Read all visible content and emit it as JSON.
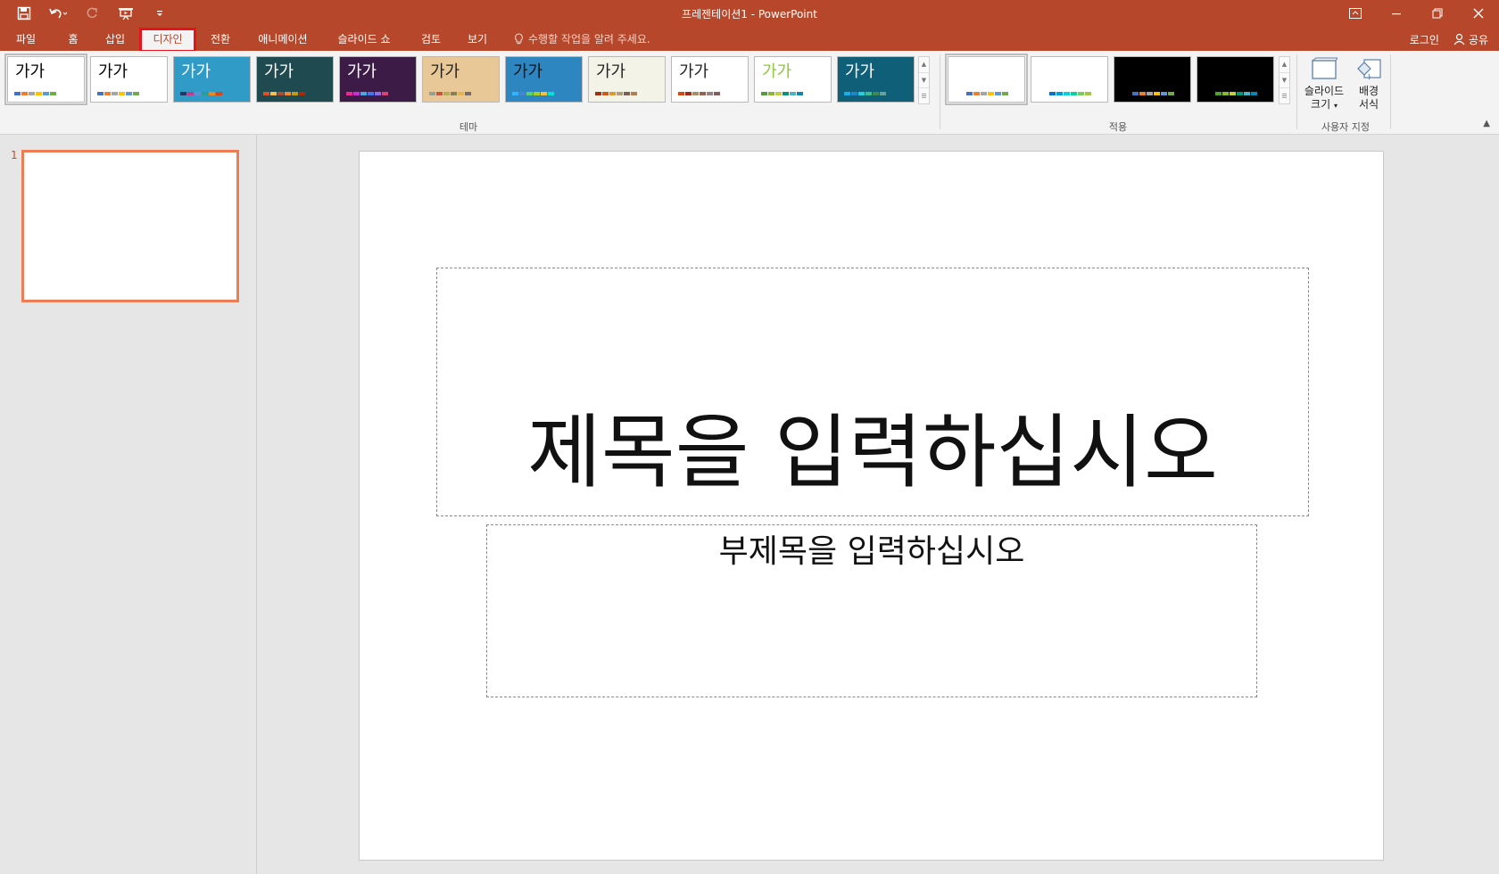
{
  "window": {
    "title": "프레젠테이션1 - PowerPoint"
  },
  "qat": {
    "icons": [
      "save-icon",
      "undo-icon",
      "redo-icon",
      "start-from-beginning-icon",
      "customize-qat-icon"
    ]
  },
  "tabs": [
    {
      "label": "파일"
    },
    {
      "label": "홈"
    },
    {
      "label": "삽입"
    },
    {
      "label": "디자인",
      "active": true
    },
    {
      "label": "전환"
    },
    {
      "label": "애니메이션"
    },
    {
      "label": "슬라이드 쇼"
    },
    {
      "label": "검토"
    },
    {
      "label": "보기"
    }
  ],
  "tell_me": "수행할 작업을 알려 주세요.",
  "account": {
    "signin": "로그인",
    "share": "공유"
  },
  "ribbon": {
    "themes_group_label": "테마",
    "variants_group_label": "적용",
    "customize_group_label": "사용자 지정",
    "themes": [
      {
        "label": "가가",
        "bg": "#ffffff",
        "fg": "#000000",
        "swatches": [
          "#4472c4",
          "#ed7d31",
          "#a5a5a5",
          "#ffc000",
          "#5b9bd5",
          "#70ad47"
        ]
      },
      {
        "label": "가가",
        "bg": "#ffffff",
        "fg": "#000000",
        "swatches": [
          "#4472c4",
          "#ed7d31",
          "#a5a5a5",
          "#ffc000",
          "#5b9bd5",
          "#70ad47"
        ]
      },
      {
        "label": "가가",
        "bg": "#2f9bc6",
        "fg": "#ffffff",
        "swatches": [
          "#1f3864",
          "#b4418e",
          "#5f91d6",
          "#24a0a0",
          "#e08b29",
          "#d34817"
        ]
      },
      {
        "label": "가가",
        "bg": "#1f4a4f",
        "fg": "#ffffff",
        "swatches": [
          "#e84c22",
          "#ffbd47",
          "#b64926",
          "#ff8427",
          "#cc9900",
          "#b22600"
        ]
      },
      {
        "label": "가가",
        "bg": "#3c1c47",
        "fg": "#ffffff",
        "swatches": [
          "#e32d91",
          "#c830cc",
          "#4ea6dc",
          "#4775e7",
          "#8971e1",
          "#d54773"
        ]
      },
      {
        "label": "가가",
        "bg": "#e8c896",
        "fg": "#222222",
        "swatches": [
          "#93a299",
          "#cf543f",
          "#b5ae53",
          "#848058",
          "#e8b54d",
          "#786c71"
        ]
      },
      {
        "label": "가가",
        "bg": "#2e86c1",
        "fg": "#111111",
        "swatches": [
          "#31b6fd",
          "#4584d3",
          "#5bd078",
          "#a5d028",
          "#f5c040",
          "#05e0db"
        ]
      },
      {
        "label": "가가",
        "bg": "#f4f3e8",
        "fg": "#222222",
        "swatches": [
          "#a5300f",
          "#d55816",
          "#e19825",
          "#b19c7d",
          "#7f5f52",
          "#b27d49"
        ]
      },
      {
        "label": "가가",
        "bg": "#ffffff",
        "fg": "#222222",
        "swatches": [
          "#d34817",
          "#9b2d1f",
          "#a28e6a",
          "#956251",
          "#918485",
          "#855d5d"
        ]
      },
      {
        "label": "가가",
        "bg": "#ffffff",
        "fg": "#8dc63f",
        "swatches": [
          "#549e39",
          "#8ab833",
          "#c0cf3a",
          "#029676",
          "#4ab5c4",
          "#0989b1"
        ]
      },
      {
        "label": "가가",
        "bg": "#0f5f78",
        "fg": "#ffffff",
        "swatches": [
          "#1cade4",
          "#2683c6",
          "#27ced7",
          "#42ba97",
          "#3e8853",
          "#62a39f"
        ]
      }
    ],
    "variants": [
      {
        "bg": "#ffffff",
        "swatches": [
          "#4472c4",
          "#ed7d31",
          "#a5a5a5",
          "#ffc000",
          "#5b9bd5",
          "#70ad47"
        ]
      },
      {
        "bg": "#ffffff",
        "swatches": [
          "#0f6fc6",
          "#009dd9",
          "#0bd0d9",
          "#10cf9b",
          "#7cca62",
          "#a5c249"
        ]
      },
      {
        "bg": "#000000",
        "swatches": [
          "#4472c4",
          "#ed7d31",
          "#a5a5a5",
          "#ffc000",
          "#5b9bd5",
          "#70ad47"
        ]
      },
      {
        "bg": "#000000",
        "swatches": [
          "#549e39",
          "#8ab833",
          "#c0cf3a",
          "#029676",
          "#4ab5c4",
          "#0989b1"
        ]
      }
    ],
    "slide_size_label_1": "슬라이드",
    "slide_size_label_2": "크기",
    "format_bg_label_1": "배경",
    "format_bg_label_2": "서식"
  },
  "slides_pane": {
    "slide_number": "1"
  },
  "slide": {
    "title_placeholder": "제목을 입력하십시오",
    "subtitle_placeholder": "부제목을 입력하십시오"
  }
}
